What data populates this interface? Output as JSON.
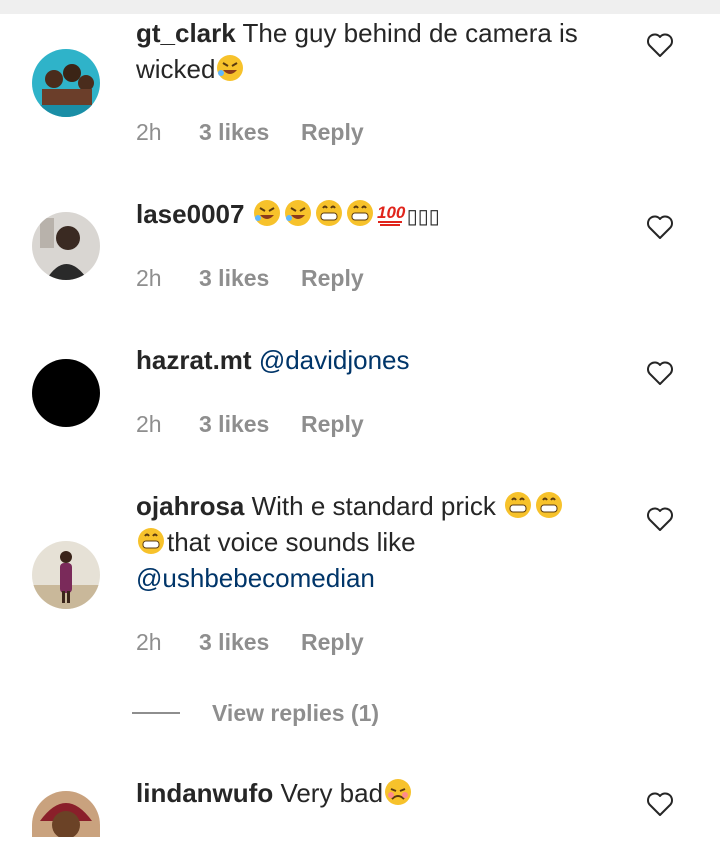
{
  "comments": [
    {
      "username": "gt_clark",
      "text": "The guy behind de camera is wicked",
      "emoji_suffix": [
        "rofl-emoji"
      ],
      "time": "2h",
      "likes": "3 likes",
      "reply": "Reply",
      "avatar": "group-photo-avatar"
    },
    {
      "username": "lase0007",
      "text": "",
      "emoji_suffix": [
        "rofl-emoji",
        "rofl-emoji",
        "grin-emoji",
        "grin-emoji",
        "hundred-emoji"
      ],
      "missing_glyphs": "▯▯▯",
      "time": "2h",
      "likes": "3 likes",
      "reply": "Reply",
      "avatar": "person-photo-avatar"
    },
    {
      "username": "hazrat.mt",
      "mention": "@davidjones",
      "time": "2h",
      "likes": "3 likes",
      "reply": "Reply",
      "avatar": "black-avatar"
    },
    {
      "username": "ojahrosa",
      "text_line1": "With e standard prick",
      "text_line2": "that voice sounds like",
      "mention": "@ushbebecomedian",
      "time": "2h",
      "likes": "3 likes",
      "reply": "Reply",
      "avatar": "person-standing-avatar"
    },
    {
      "username": "lindanwufo",
      "text": "Very bad",
      "emoji_suffix": [
        "sad-emoji"
      ],
      "avatar": "woman-photo-avatar"
    }
  ],
  "view_replies": "View replies (1)",
  "colors": {
    "text": "#262626",
    "meta": "#8e8e8e",
    "mention": "#003569",
    "emoji": "#f7c22b"
  }
}
